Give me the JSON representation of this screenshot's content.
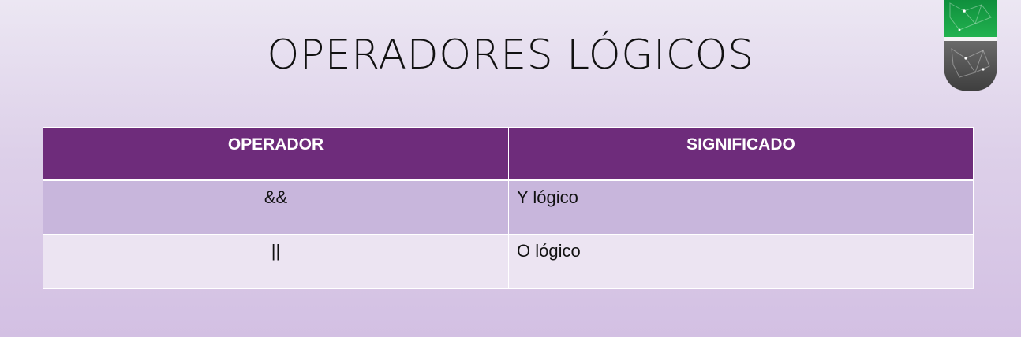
{
  "slide": {
    "title": "OPERADORES LÓGICOS"
  },
  "table": {
    "headers": [
      "OPERADOR",
      "SIGNIFICADO"
    ],
    "rows": [
      {
        "operator": "&&",
        "meaning": "Y lógico"
      },
      {
        "operator": "||",
        "meaning": "O lógico"
      }
    ]
  },
  "colors": {
    "header_bg": "#6e2c7b",
    "row_dark": "#c8b6dc",
    "row_light": "#ece4f2",
    "logo_green": "#1aa34a",
    "logo_gray": "#5a5a5a"
  },
  "icons": {
    "logo": "brand-logo-icon"
  }
}
